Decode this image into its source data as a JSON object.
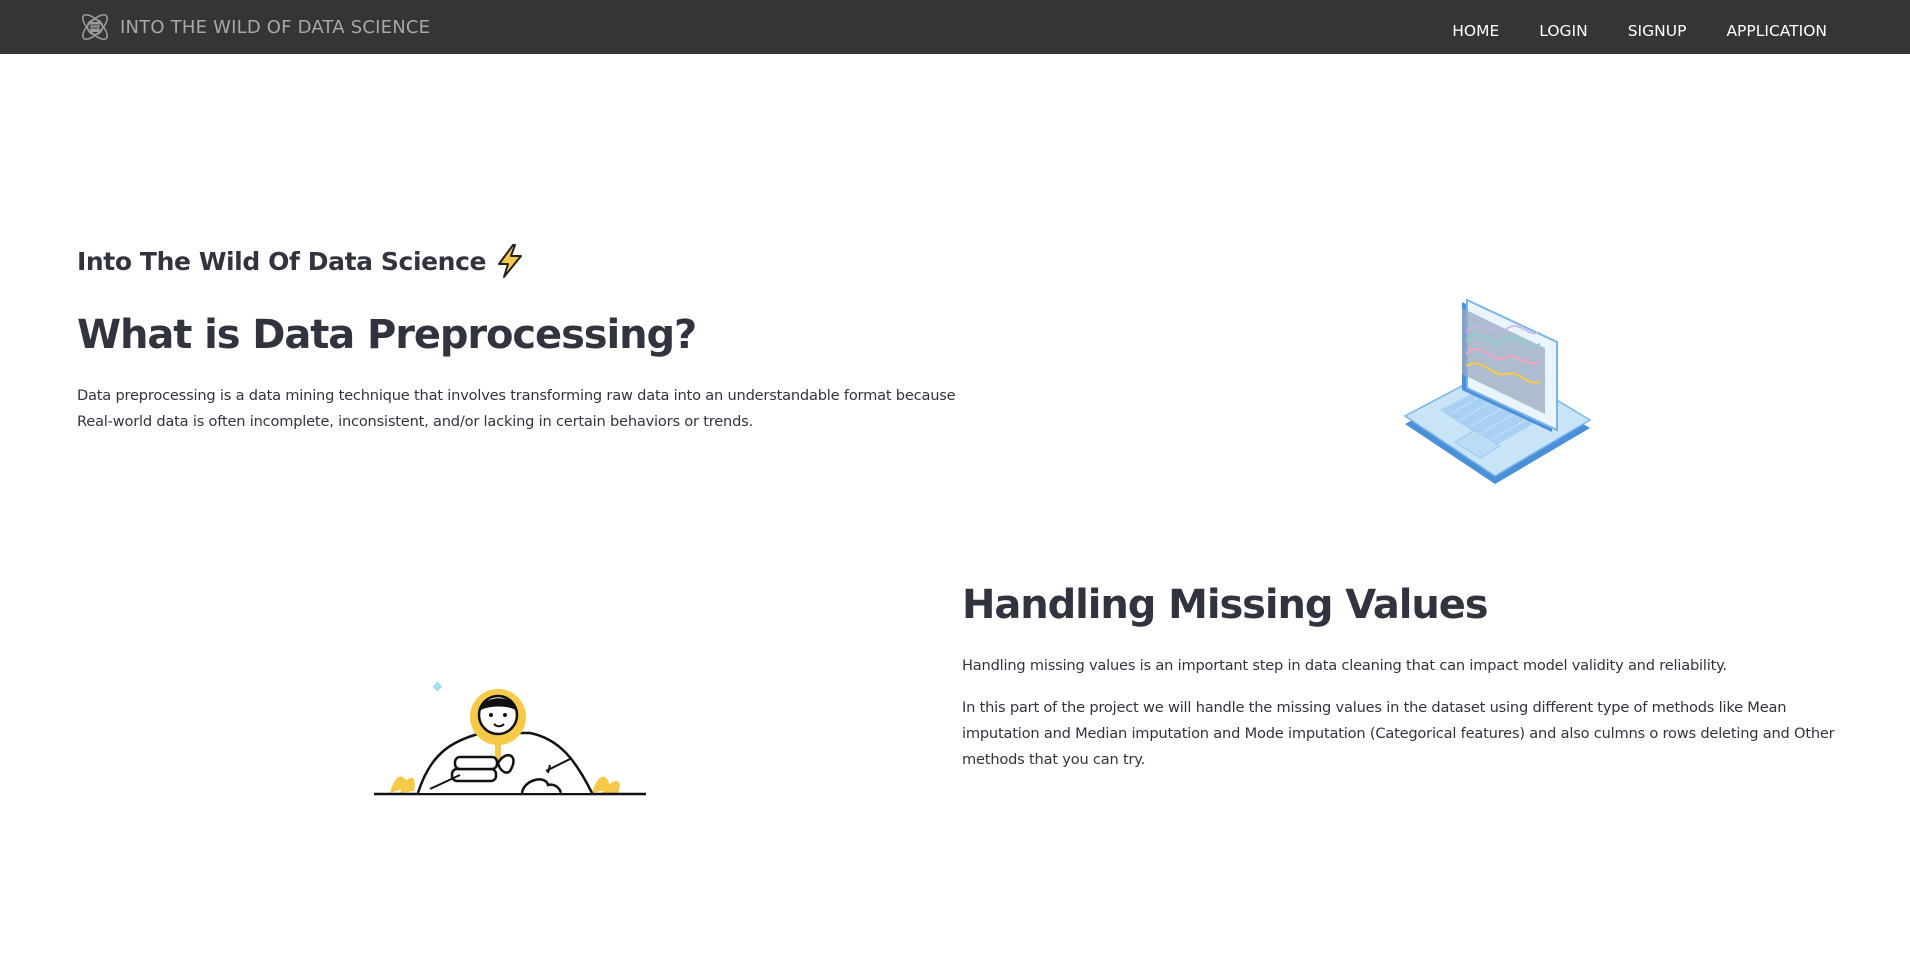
{
  "navbar": {
    "brand_text": "INTO THE WILD OF DATA SCIENCE",
    "brand_icon": "atom-data-logo-icon",
    "links": [
      {
        "label": "HOME"
      },
      {
        "label": "LOGIN"
      },
      {
        "label": "SIGNUP"
      },
      {
        "label": "APPLICATION"
      }
    ]
  },
  "hero": {
    "tagline": "Into The Wild Of Data Science",
    "tagline_icon": "lightning-bolt-icon",
    "title": "What is Data Preprocessing?",
    "description": "Data preprocessing is a data mining technique that involves transforming raw data into an understandable format because Real-world data is often incomplete, inconsistent, and/or lacking in certain behaviors or trends.",
    "illustration": "laptop-chart-illustration"
  },
  "missing_values": {
    "title": "Handling Missing Values",
    "paragraph_1": "Handling missing values is an important step in data cleaning that can impact model validity and reliability.",
    "paragraph_2": "In this part of the project we will handle the missing values in the dataset using different type of methods like Mean imputation and Median imputation and Mode imputation (Categorical features) and also culmns o rows deleting and Other methods that you can try.",
    "illustration": "person-magnifier-illustration"
  },
  "colors": {
    "navbar_bg": "#353535",
    "nav_text": "#ffffff",
    "brand_text": "#a8a8a8",
    "body_text": "#31333f",
    "accent_yellow": "#f7c948",
    "accent_blue": "#4a90d9"
  }
}
